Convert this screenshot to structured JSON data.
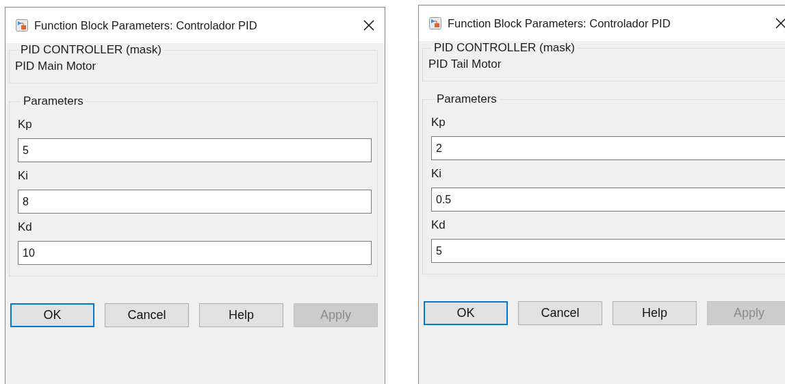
{
  "dialogs": [
    {
      "window": {
        "title": "Function Block Parameters: Controlador PID"
      },
      "mask": {
        "title": "PID CONTROLLER  (mask)",
        "description": "PID Main Motor"
      },
      "parameters": {
        "title": "Parameters",
        "fields": [
          {
            "label": "Kp",
            "value": "5"
          },
          {
            "label": "Ki",
            "value": "8"
          },
          {
            "label": "Kd",
            "value": "10"
          }
        ]
      },
      "buttons": [
        {
          "label": "OK",
          "default": true,
          "disabled": false
        },
        {
          "label": "Cancel",
          "default": false,
          "disabled": false
        },
        {
          "label": "Help",
          "default": false,
          "disabled": false
        },
        {
          "label": "Apply",
          "default": false,
          "disabled": true
        }
      ]
    },
    {
      "window": {
        "title": "Function Block Parameters: Controlador PID"
      },
      "mask": {
        "title": "PID CONTROLLER  (mask)",
        "description": "PID Tail Motor"
      },
      "parameters": {
        "title": "Parameters",
        "fields": [
          {
            "label": "Kp",
            "value": "2"
          },
          {
            "label": "Ki",
            "value": "0.5"
          },
          {
            "label": "Kd",
            "value": "5"
          }
        ]
      },
      "buttons": [
        {
          "label": "OK",
          "default": true,
          "disabled": false
        },
        {
          "label": "Cancel",
          "default": false,
          "disabled": false
        },
        {
          "label": "Help",
          "default": false,
          "disabled": false
        },
        {
          "label": "Apply",
          "default": false,
          "disabled": true
        }
      ]
    }
  ]
}
